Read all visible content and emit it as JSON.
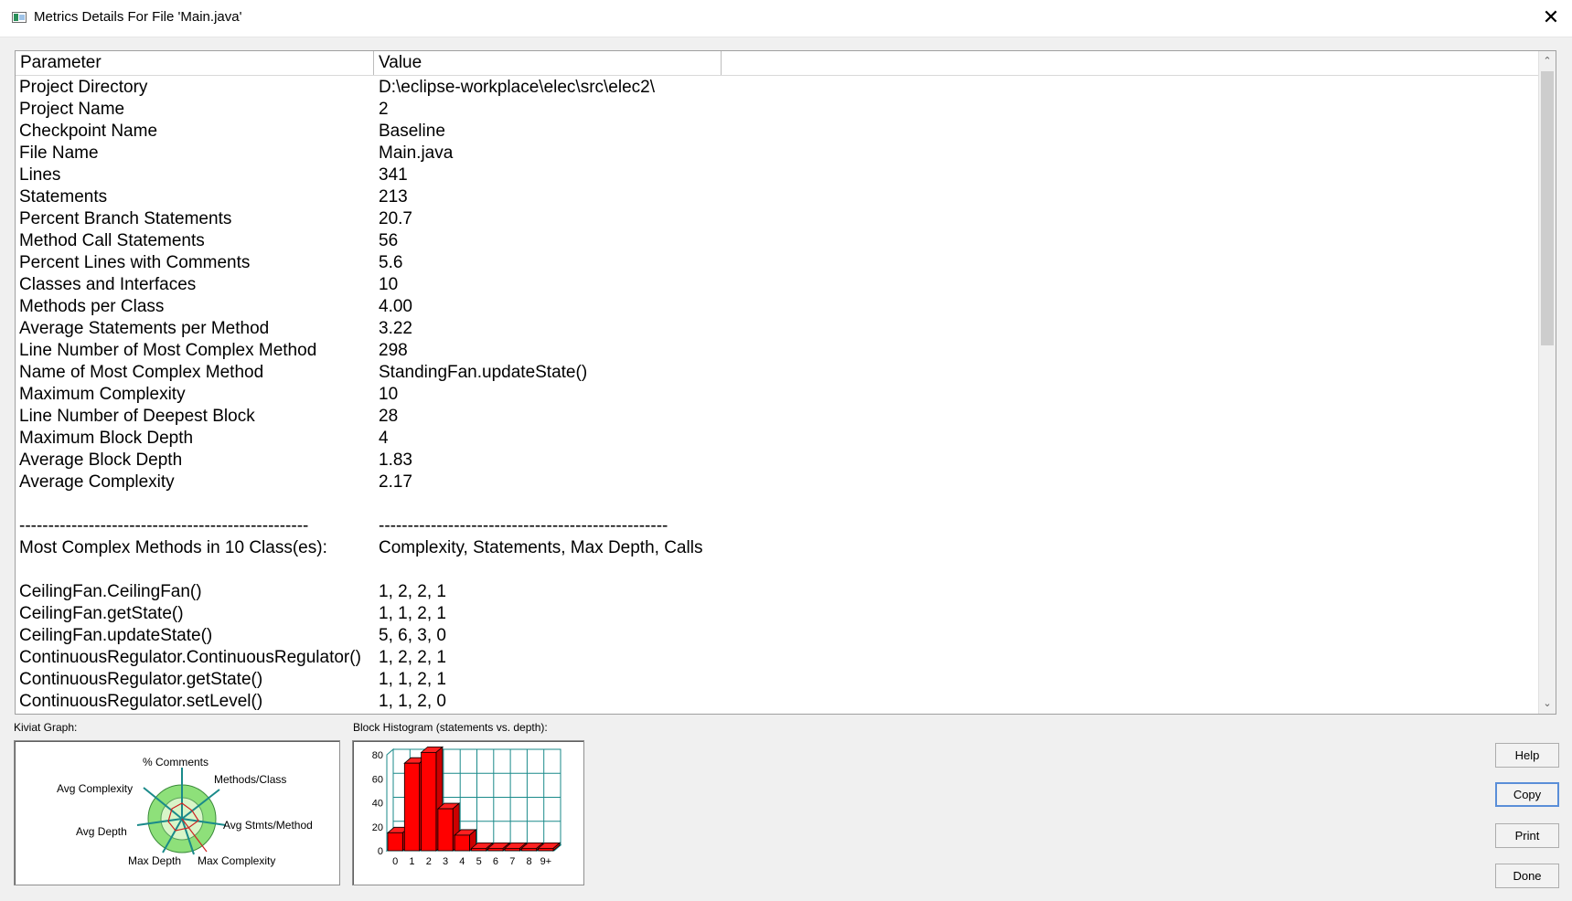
{
  "window": {
    "title": "Metrics Details For File 'Main.java'"
  },
  "table": {
    "headers": {
      "parameter": "Parameter",
      "value": "Value"
    },
    "rows": [
      [
        "Project Directory",
        "D:\\eclipse-workplace\\elec\\src\\elec2\\"
      ],
      [
        "Project Name",
        "2"
      ],
      [
        "Checkpoint Name",
        "Baseline"
      ],
      [
        "File Name",
        "Main.java"
      ],
      [
        "Lines",
        "341"
      ],
      [
        "Statements",
        "213"
      ],
      [
        "Percent Branch Statements",
        "20.7"
      ],
      [
        "Method Call Statements",
        "56"
      ],
      [
        "Percent Lines with Comments",
        "5.6"
      ],
      [
        "Classes and Interfaces",
        "10"
      ],
      [
        "Methods per Class",
        "4.00"
      ],
      [
        "Average Statements per Method",
        "3.22"
      ],
      [
        "Line Number of Most Complex Method",
        "298"
      ],
      [
        "Name of Most Complex Method",
        "StandingFan.updateState()"
      ],
      [
        "Maximum Complexity",
        "10"
      ],
      [
        "Line Number of Deepest Block",
        "28"
      ],
      [
        "Maximum Block Depth",
        "4"
      ],
      [
        "Average Block Depth",
        "1.83"
      ],
      [
        "Average Complexity",
        "2.17"
      ],
      [
        "",
        ""
      ],
      [
        "--------------------------------------------------",
        "--------------------------------------------------"
      ],
      [
        "Most Complex Methods in 10 Class(es):",
        "Complexity, Statements, Max Depth, Calls"
      ],
      [
        "",
        ""
      ],
      [
        "CeilingFan.CeilingFan()",
        "1, 2, 2, 1"
      ],
      [
        "CeilingFan.getState()",
        "1, 1, 2, 1"
      ],
      [
        "CeilingFan.updateState()",
        "5, 6, 3, 0"
      ],
      [
        "ContinuousRegulator.ContinuousRegulator()",
        "1, 2, 2, 1"
      ],
      [
        "ContinuousRegulator.getState()",
        "1, 1, 2, 1"
      ],
      [
        "ContinuousRegulator.setLevel()",
        "1, 1, 2, 0"
      ]
    ]
  },
  "kiviat": {
    "label": "Kiviat Graph:",
    "axes": [
      "% Comments",
      "Methods/Class",
      "Avg Stmts/Method",
      "Max Complexity",
      "Max Depth",
      "Avg Depth",
      "Avg Complexity"
    ]
  },
  "histogram": {
    "label": "Block Histogram (statements vs. depth):",
    "y_ticks": [
      "80",
      "60",
      "40",
      "20",
      "0"
    ],
    "x_ticks": [
      "0",
      "1",
      "2",
      "3",
      "4",
      "5",
      "6",
      "7",
      "8",
      "9+"
    ]
  },
  "chart_data": {
    "type": "bar",
    "categories": [
      "0",
      "1",
      "2",
      "3",
      "4",
      "5",
      "6",
      "7",
      "8",
      "9+"
    ],
    "values": [
      15,
      73,
      82,
      35,
      13,
      0,
      0,
      0,
      0,
      0
    ],
    "ylim": [
      0,
      80
    ],
    "grid": true
  },
  "buttons": {
    "help": "Help",
    "copy": "Copy",
    "print": "Print",
    "done": "Done"
  }
}
